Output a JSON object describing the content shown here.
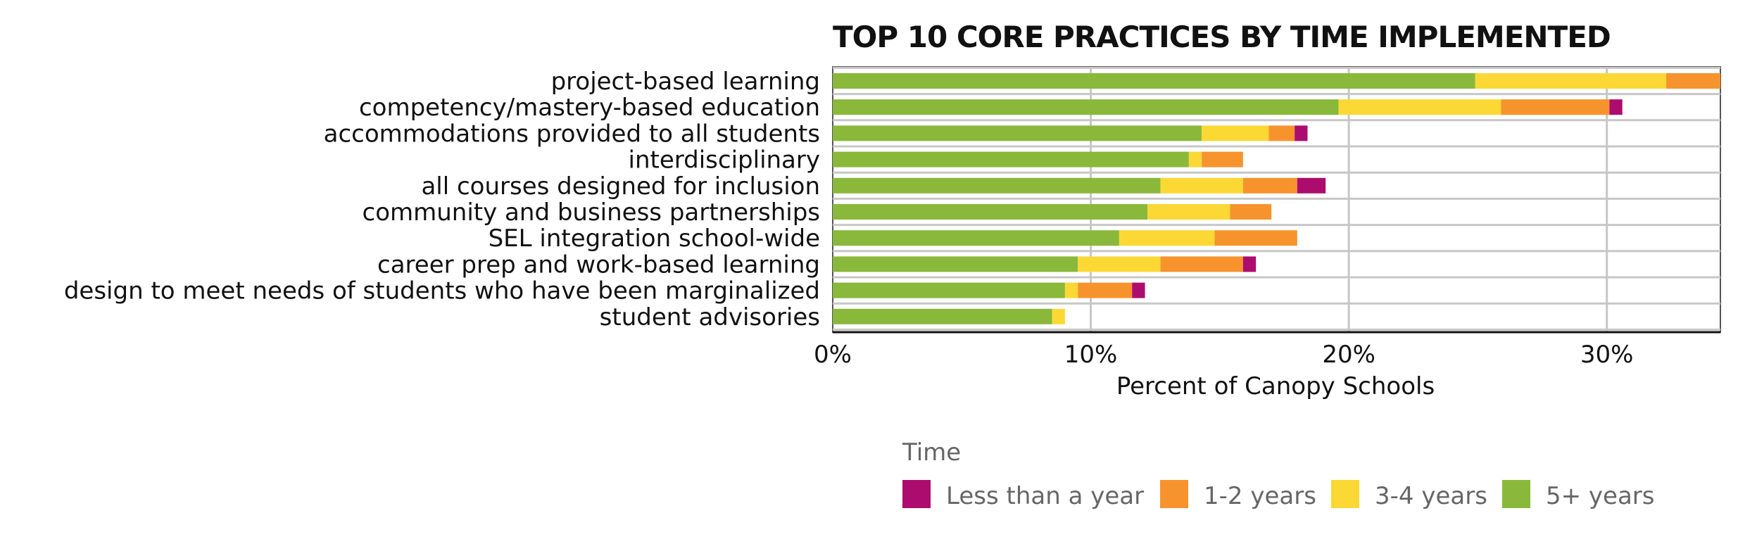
{
  "chart_data": {
    "type": "bar",
    "orientation": "horizontal",
    "stacked": true,
    "title": "TOP 10 CORE PRACTICES BY TIME IMPLEMENTED",
    "xlabel": "Percent of Canopy Schools",
    "ylabel": "",
    "xlim": [
      0,
      34.4
    ],
    "xticks": [
      0,
      10,
      20,
      30
    ],
    "xtick_labels": [
      "0%",
      "10%",
      "20%",
      "30%"
    ],
    "grid": "vertical",
    "legend": {
      "title": "Time",
      "placement": "bottom",
      "entries": [
        "Less than a year",
        "1-2 years",
        "3-4 years",
        "5+ years"
      ]
    },
    "categories": [
      "project-based learning",
      "competency/mastery-based education",
      "accommodations provided to all students",
      "interdisciplinary",
      "all courses designed for inclusion",
      "community and business partnerships",
      "SEL integration school-wide",
      "career prep and work-based learning",
      "design to meet needs of students who have been marginalized",
      "student advisories"
    ],
    "series": [
      {
        "name": "5+ years",
        "color": "#8ab83a",
        "values": [
          24.9,
          19.6,
          14.3,
          13.8,
          12.7,
          12.2,
          11.1,
          9.5,
          9.0,
          8.5
        ]
      },
      {
        "name": "3-4 years",
        "color": "#fcd835",
        "values": [
          7.4,
          6.3,
          2.6,
          0.5,
          3.2,
          3.2,
          3.7,
          3.2,
          0.5,
          0.5
        ]
      },
      {
        "name": "1-2 years",
        "color": "#f7932d",
        "values": [
          2.1,
          4.2,
          1.0,
          1.6,
          2.1,
          1.6,
          3.2,
          3.2,
          2.1,
          0
        ]
      },
      {
        "name": "Less than a year",
        "color": "#ad0c6f",
        "values": [
          0,
          0.5,
          0.5,
          0,
          1.1,
          0,
          0,
          0.5,
          0.5,
          0
        ]
      }
    ]
  }
}
